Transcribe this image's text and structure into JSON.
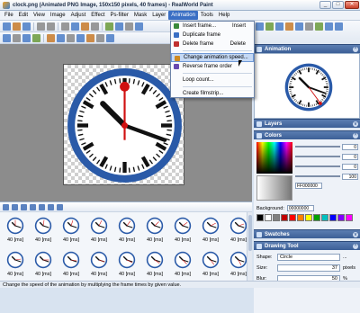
{
  "window": {
    "title": "clock.png (Animated PNG Image, 150x150 pixels, 40 frames) - RealWorld Paint",
    "minimize": "_",
    "maximize": "□",
    "close": "✕"
  },
  "menubar": {
    "items": [
      "File",
      "Edit",
      "View",
      "Image",
      "Adjust",
      "Effect",
      "Ps-filter",
      "Mask",
      "Layer",
      "Animation",
      "Tools",
      "Help"
    ],
    "active": "Animation"
  },
  "animation_menu": {
    "items": [
      {
        "label": "Insert frame...",
        "shortcut": "Insert",
        "icon": "insert-frame-icon"
      },
      {
        "label": "Duplicate frame",
        "shortcut": "",
        "icon": "duplicate-frame-icon"
      },
      {
        "label": "Delete frame",
        "shortcut": "Delete",
        "icon": "delete-frame-icon"
      },
      {
        "label": "Change animation speed...",
        "shortcut": "",
        "icon": "animation-speed-icon"
      },
      {
        "label": "Reverse frame order",
        "shortcut": "",
        "icon": "reverse-order-icon"
      },
      {
        "label": "Loop count...",
        "shortcut": "",
        "icon": ""
      },
      {
        "label": "Create filmstrip...",
        "shortcut": "",
        "icon": ""
      }
    ],
    "highlighted": "Change animation speed..."
  },
  "frames": {
    "label": "40 [ms]",
    "visible_count": 18
  },
  "panels": {
    "animation": "Animation",
    "layers": "Layers",
    "colors": "Colors",
    "swatches": "Swatches",
    "drawing_tool": "Drawing Tool"
  },
  "colors": {
    "slider_values": [
      "0",
      "0",
      "0",
      "100"
    ],
    "hex_value": "FF000000",
    "background_label": "Background:",
    "background_value": "00000000",
    "palette": [
      "#000000",
      "#ffffff",
      "#808080",
      "#c00000",
      "#ff0000",
      "#ff8000",
      "#ffff00",
      "#00a000",
      "#00c0c0",
      "#0000ff",
      "#8000ff",
      "#ff00ff"
    ]
  },
  "drawing_tool": {
    "shape_label": "Shape:",
    "shape_value": "Circle",
    "size_label": "Size:",
    "size_value": "37",
    "size_unit": "pixels",
    "blur_label": "Blur:",
    "blur_value": "50",
    "blur_unit": "%"
  },
  "status": {
    "text": "Change the speed of the animation by multiplying the frame times by given value."
  },
  "clock": {
    "face": "#ffffff",
    "rim": "#2a5aa8",
    "hands": "#111111",
    "second_hand": "#d01010"
  }
}
